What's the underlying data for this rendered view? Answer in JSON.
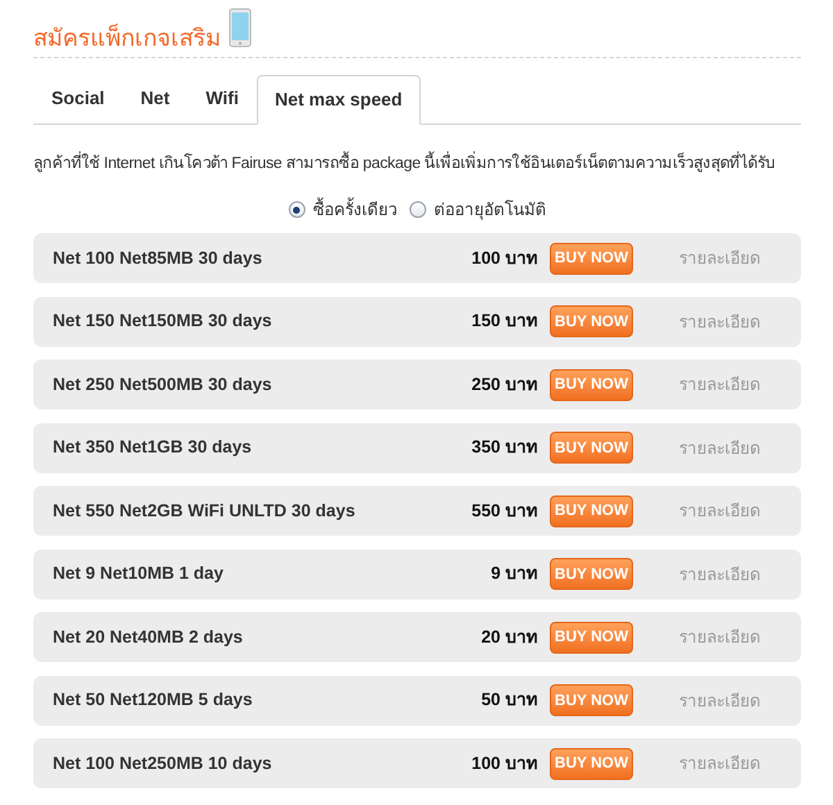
{
  "title": "สมัครแพ็กเกจเสริม",
  "tabs": [
    {
      "label": "Social",
      "selected": false
    },
    {
      "label": "Net",
      "selected": false
    },
    {
      "label": "Wifi",
      "selected": false
    },
    {
      "label": "Net max speed",
      "selected": true
    }
  ],
  "description": "ลูกค้าที่ใช้ Internet เกินโควต้า Fairuse สามารถซื้อ package นี้เพื่อเพิ่มการใช้อินเตอร์เน็ตตามความเร็วสูงสุดที่ได้รับ",
  "purchase_options": [
    {
      "label": "ซื้อครั้งเดียว",
      "selected": true
    },
    {
      "label": "ต่ออายุอัตโนมัติ",
      "selected": false
    }
  ],
  "packages": [
    {
      "name": "Net 100 Net85MB 30 days",
      "price": "100 บาท",
      "button": "BUY NOW",
      "details": "รายละเอียด"
    },
    {
      "name": "Net 150 Net150MB 30 days",
      "price": "150 บาท",
      "button": "BUY NOW",
      "details": "รายละเอียด"
    },
    {
      "name": "Net 250 Net500MB 30 days",
      "price": "250 บาท",
      "button": "BUY NOW",
      "details": "รายละเอียด"
    },
    {
      "name": "Net 350 Net1GB 30 days",
      "price": "350 บาท",
      "button": "BUY NOW",
      "details": "รายละเอียด"
    },
    {
      "name": "Net 550 Net2GB WiFi UNLTD 30 days",
      "price": "550 บาท",
      "button": "BUY NOW",
      "details": "รายละเอียด"
    },
    {
      "name": "Net 9 Net10MB 1 day",
      "price": "9 บาท",
      "button": "BUY NOW",
      "details": "รายละเอียด"
    },
    {
      "name": "Net 20 Net40MB 2 days",
      "price": "20 บาท",
      "button": "BUY NOW",
      "details": "รายละเอียด"
    },
    {
      "name": "Net 50 Net120MB 5 days",
      "price": "50 บาท",
      "button": "BUY NOW",
      "details": "รายละเอียด"
    },
    {
      "name": "Net 100 Net250MB 10 days",
      "price": "100 บาท",
      "button": "BUY NOW",
      "details": "รายละเอียด"
    }
  ]
}
